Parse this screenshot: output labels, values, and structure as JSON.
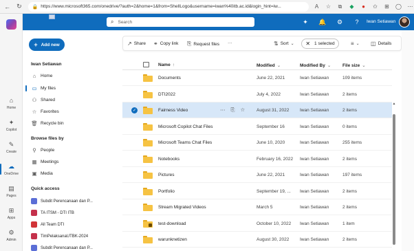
{
  "browser": {
    "url": "https://www.microsoft365.com/onedrive/?auth=2&home=1&from=ShellLogo&username=iwan%40itb.ac.id&login_hint=iw...",
    "icons": [
      "aa-icon",
      "star-icon",
      "extension-icon",
      "shield-icon",
      "refresh-icon",
      "puzzle-icon",
      "menu-icon"
    ]
  },
  "rail": {
    "items": [
      {
        "label": "Home",
        "icon": "home-icon"
      },
      {
        "label": "Copilot",
        "icon": "copilot-icon"
      },
      {
        "label": "Create",
        "icon": "create-icon"
      },
      {
        "label": "OneDrive",
        "icon": "onedrive-icon"
      },
      {
        "label": "Pages",
        "icon": "pages-icon"
      },
      {
        "label": "Apps",
        "icon": "apps-icon"
      },
      {
        "label": "Admin",
        "icon": "admin-icon"
      }
    ]
  },
  "topbar": {
    "search_placeholder": "Search",
    "user_name": "Iwan Setiawan"
  },
  "left_nav": {
    "add_new_label": "Add new",
    "user": "Iwan Setiawan",
    "items": [
      {
        "label": "Home"
      },
      {
        "label": "My files"
      },
      {
        "label": "Shared"
      },
      {
        "label": "Favorites"
      },
      {
        "label": "Recycle bin"
      }
    ],
    "browse_heading": "Browse files by",
    "browse_items": [
      {
        "label": "People"
      },
      {
        "label": "Meetings"
      },
      {
        "label": "Media"
      }
    ],
    "quick_access_heading": "Quick access",
    "quick_access": [
      {
        "label": "Subdit Perencanaan dan P...",
        "color": "#5b6ed6"
      },
      {
        "label": "TA ITSM - DTI ITB",
        "color": "#c4314b"
      },
      {
        "label": "All Team DTI",
        "color": "#d13438"
      },
      {
        "label": "TimPelaksanaUTBK-2024",
        "color": "#c4314b"
      },
      {
        "label": "Subdit Perencanaan dan P...",
        "color": "#5b6ed6"
      }
    ]
  },
  "commands": {
    "share": "Share",
    "copy_link": "Copy link",
    "request_files": "Request files",
    "more": "···",
    "sort": "Sort",
    "selected": "1 selected",
    "details": "Details"
  },
  "table": {
    "headers": {
      "name": "Name",
      "modified": "Modified",
      "modified_by": "Modified By",
      "size": "File size"
    },
    "rows": [
      {
        "name": "Documents",
        "modified": "June 22, 2021",
        "by": "Iwan Setiawan",
        "size": "109 items",
        "selected": false,
        "locked": false
      },
      {
        "name": "DTI2022",
        "modified": "July 4, 2022",
        "by": "Iwan Setiawan",
        "size": "2 items",
        "selected": false,
        "locked": false
      },
      {
        "name": "Fairness Video",
        "modified": "August 31, 2022",
        "by": "Iwan Setiawan",
        "size": "2 items",
        "selected": true,
        "locked": false
      },
      {
        "name": "Microsoft Copilot Chat Files",
        "modified": "September 16",
        "by": "Iwan Setiawan",
        "size": "0 items",
        "selected": false,
        "locked": false
      },
      {
        "name": "Microsoft Teams Chat Files",
        "modified": "June 10, 2020",
        "by": "Iwan Setiawan",
        "size": "255 items",
        "selected": false,
        "locked": false
      },
      {
        "name": "Notebooks",
        "modified": "February 16, 2022",
        "by": "Iwan Setiawan",
        "size": "2 items",
        "selected": false,
        "locked": false
      },
      {
        "name": "Pictures",
        "modified": "June 22, 2021",
        "by": "Iwan Setiawan",
        "size": "197 items",
        "selected": false,
        "locked": false
      },
      {
        "name": "Portfolio",
        "modified": "September 19, ...",
        "by": "Iwan Setiawan",
        "size": "2 items",
        "selected": false,
        "locked": false
      },
      {
        "name": "Stream Migrated Videos",
        "modified": "March 5",
        "by": "Iwan Setiawan",
        "size": "2 items",
        "selected": false,
        "locked": false
      },
      {
        "name": "test-download",
        "modified": "October 10, 2022",
        "by": "Iwan Setiawan",
        "size": "1 item",
        "selected": false,
        "locked": true
      },
      {
        "name": "warunknetizen",
        "modified": "August 30, 2022",
        "by": "Iwan Setiawan",
        "size": "2 items",
        "selected": false,
        "locked": false
      }
    ]
  }
}
